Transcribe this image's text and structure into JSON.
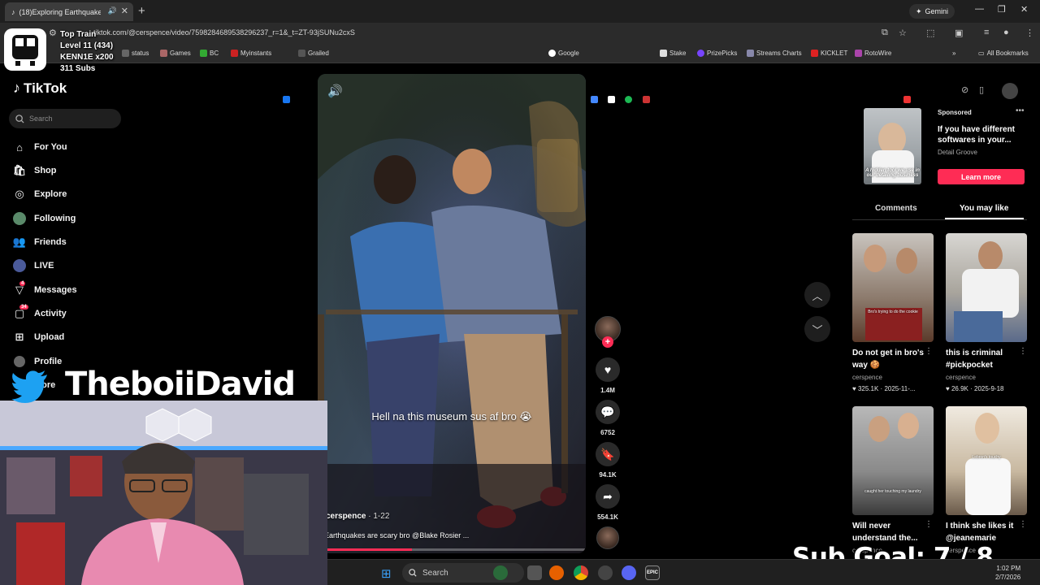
{
  "browser": {
    "tab_title": "(18)Exploring Earthquakes",
    "gemini_label": "Gemini",
    "url": "tiktok.com/@cerspence/video/7598284689538296237_r=1&_t=ZT-93jSUNu2cxS",
    "bookmarks": [
      "status",
      "Games",
      "BC",
      "Myinstants",
      "Grailed",
      "Google",
      "Stake",
      "PrizePicks",
      "Streams Charts",
      "KICKLET",
      "RotoWire"
    ],
    "all_bookmarks": "All Bookmarks"
  },
  "sidebar": {
    "logo": "TikTok",
    "search_placeholder": "Search",
    "items": [
      {
        "label": "For You",
        "icon": "home-icon"
      },
      {
        "label": "Shop",
        "icon": "shop-icon"
      },
      {
        "label": "Explore",
        "icon": "compass-icon"
      },
      {
        "label": "Following",
        "icon": "following-icon"
      },
      {
        "label": "Friends",
        "icon": "friends-icon"
      },
      {
        "label": "LIVE",
        "icon": "live-icon"
      },
      {
        "label": "Messages",
        "icon": "messages-icon",
        "badge": "4"
      },
      {
        "label": "Activity",
        "icon": "activity-icon",
        "badge": "34"
      },
      {
        "label": "Upload",
        "icon": "upload-icon"
      },
      {
        "label": "Profile",
        "icon": "profile-icon"
      },
      {
        "label": "More",
        "icon": "more-icon"
      }
    ]
  },
  "video": {
    "caption": "Hell na this museum sus af bro 😭",
    "author": "cerspence",
    "date": "· 1-22",
    "description": "Earthquakes are scary bro @Blake Rosier ...",
    "progress": 0.35
  },
  "actions": {
    "likes": "1.4M",
    "comments": "6752",
    "saves": "94.1K",
    "shares": "554.1K"
  },
  "ad": {
    "sponsored": "Sponsored",
    "title": "If you have different softwares in your...",
    "brand": "Detail Groove",
    "cta": "Learn more",
    "thumb_text": "A hidden tool we use in our detailing business"
  },
  "panel_tabs": {
    "comments": "Comments",
    "you_may_like": "You may like"
  },
  "cards": [
    {
      "title": "Do not get in bro's way 🍪",
      "author": "cerspence",
      "stats": "♥ 325.1K · 2025-11-...",
      "thumb_text": "Bro's trying to do the cookie"
    },
    {
      "title": "this is criminal #pickpocket",
      "author": "cerspence",
      "stats": "♥ 26.9K · 2025-9-18",
      "thumb_text": ""
    },
    {
      "title": "Will never understand the...",
      "author": "cerspence",
      "stats": "",
      "thumb_text": "caught her touching my laundry"
    },
    {
      "title": "I think she likes it @jeanemarie",
      "author": "cerspence",
      "stats": "",
      "thumb_text": "Lebron's touchy"
    }
  ],
  "overlay": {
    "train_title": "Top Train",
    "train_level": "Level 11  (434)",
    "train_user": "KENN1E x200",
    "train_subs": "311 Subs",
    "handle": "TheboiiDavid",
    "sub_goal": "Sub Goal:  7 / 8"
  },
  "taskbar": {
    "search": "Search",
    "time": "1:02 PM",
    "date": "2/7/2026"
  },
  "colors": {
    "accent": "#fe2c55",
    "twitter": "#1da1f2",
    "background": "#000000"
  }
}
